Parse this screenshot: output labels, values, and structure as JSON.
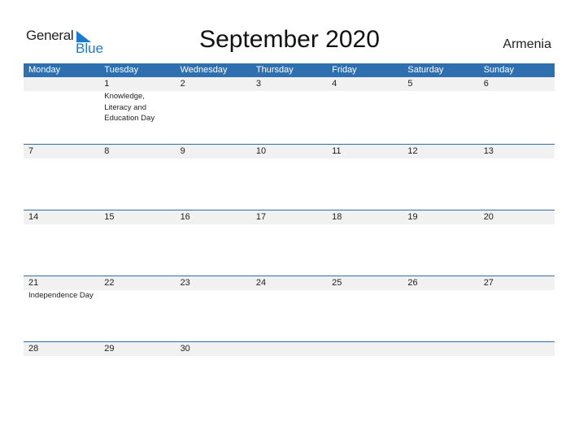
{
  "logo": {
    "general": "General",
    "blue": "Blue"
  },
  "title": "September 2020",
  "country": "Armenia",
  "colors": {
    "accent": "#2e6fb0",
    "date_band": "#f1f1f1",
    "logo_blue": "#1a7ad0"
  },
  "weekdays": [
    "Monday",
    "Tuesday",
    "Wednesday",
    "Thursday",
    "Friday",
    "Saturday",
    "Sunday"
  ],
  "weeks": [
    [
      {
        "day": ""
      },
      {
        "day": "1",
        "event": "Knowledge, Literacy and Education Day"
      },
      {
        "day": "2"
      },
      {
        "day": "3"
      },
      {
        "day": "4"
      },
      {
        "day": "5"
      },
      {
        "day": "6"
      }
    ],
    [
      {
        "day": "7"
      },
      {
        "day": "8"
      },
      {
        "day": "9"
      },
      {
        "day": "10"
      },
      {
        "day": "11"
      },
      {
        "day": "12"
      },
      {
        "day": "13"
      }
    ],
    [
      {
        "day": "14"
      },
      {
        "day": "15"
      },
      {
        "day": "16"
      },
      {
        "day": "17"
      },
      {
        "day": "18"
      },
      {
        "day": "19"
      },
      {
        "day": "20"
      }
    ],
    [
      {
        "day": "21",
        "event": "Independence Day"
      },
      {
        "day": "22"
      },
      {
        "day": "23"
      },
      {
        "day": "24"
      },
      {
        "day": "25"
      },
      {
        "day": "26"
      },
      {
        "day": "27"
      }
    ],
    [
      {
        "day": "28"
      },
      {
        "day": "29"
      },
      {
        "day": "30"
      },
      {
        "day": ""
      },
      {
        "day": ""
      },
      {
        "day": ""
      },
      {
        "day": ""
      }
    ]
  ]
}
